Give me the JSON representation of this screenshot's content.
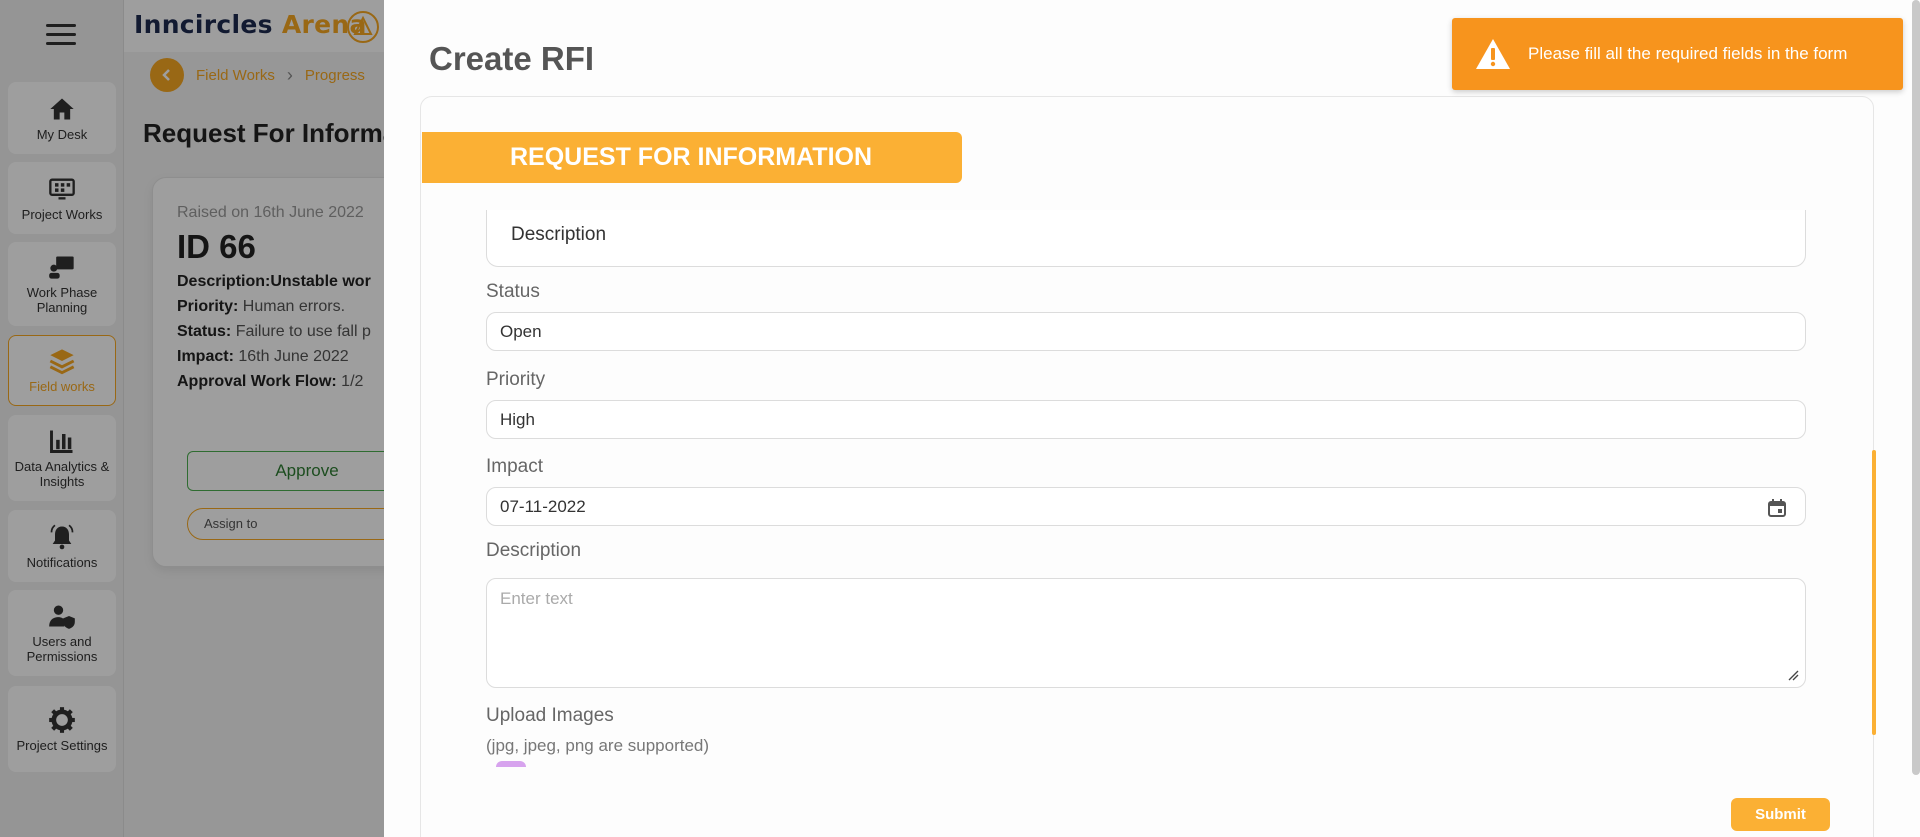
{
  "app": {
    "brand_main": "Inncircles",
    "brand_accent": "Arena"
  },
  "sidebar": {
    "items": [
      {
        "label": "My Desk",
        "icon": "home-icon"
      },
      {
        "label": "Project Works",
        "icon": "dashboard-icon"
      },
      {
        "label": "Work Phase Planning",
        "icon": "presentation-icon"
      },
      {
        "label": "Field works",
        "icon": "layers-icon",
        "active": true
      },
      {
        "label": "Data Analytics & Insights",
        "icon": "bar-chart-icon"
      },
      {
        "label": "Notifications",
        "icon": "bell-icon"
      },
      {
        "label": "Users and Permissions",
        "icon": "user-shield-icon"
      },
      {
        "label": "Project Settings",
        "icon": "gear-icon"
      }
    ]
  },
  "breadcrumb": {
    "items": [
      "Field Works",
      "Progress"
    ]
  },
  "page": {
    "title": "Request For Informa"
  },
  "card": {
    "raised": "Raised on 16th June 2022",
    "id": "ID 66",
    "description_label": "Description:",
    "description_value": "Unstable wor",
    "priority_label": "Priority:",
    "priority_value": "Human errors.",
    "status_label": "Status:",
    "status_value": "Failure to use fall p",
    "impact_label": "Impact:",
    "impact_value": "16th June 2022",
    "workflow_label": "Approval Work Flow:",
    "workflow_value": "1/2",
    "approve_label": "Approve",
    "assign_label": "Assign to"
  },
  "modal": {
    "title": "Create RFI",
    "banner": "REQUEST FOR INFORMATION",
    "top_description": "Description",
    "fields": {
      "status_label": "Status",
      "status_value": "Open",
      "priority_label": "Priority",
      "priority_value": "High",
      "impact_label": "Impact",
      "impact_value": "07-11-2022",
      "description_label": "Description",
      "description_placeholder": "Enter text",
      "upload_label": "Upload Images",
      "upload_hint": "(jpg, jpeg, png are supported)"
    },
    "submit_label": "Submit"
  },
  "toast": {
    "message": "Please fill all the required fields in the form",
    "color": "#f7941d"
  },
  "colors": {
    "accent": "#fbb034",
    "brand_navy": "#1d2b4f"
  }
}
